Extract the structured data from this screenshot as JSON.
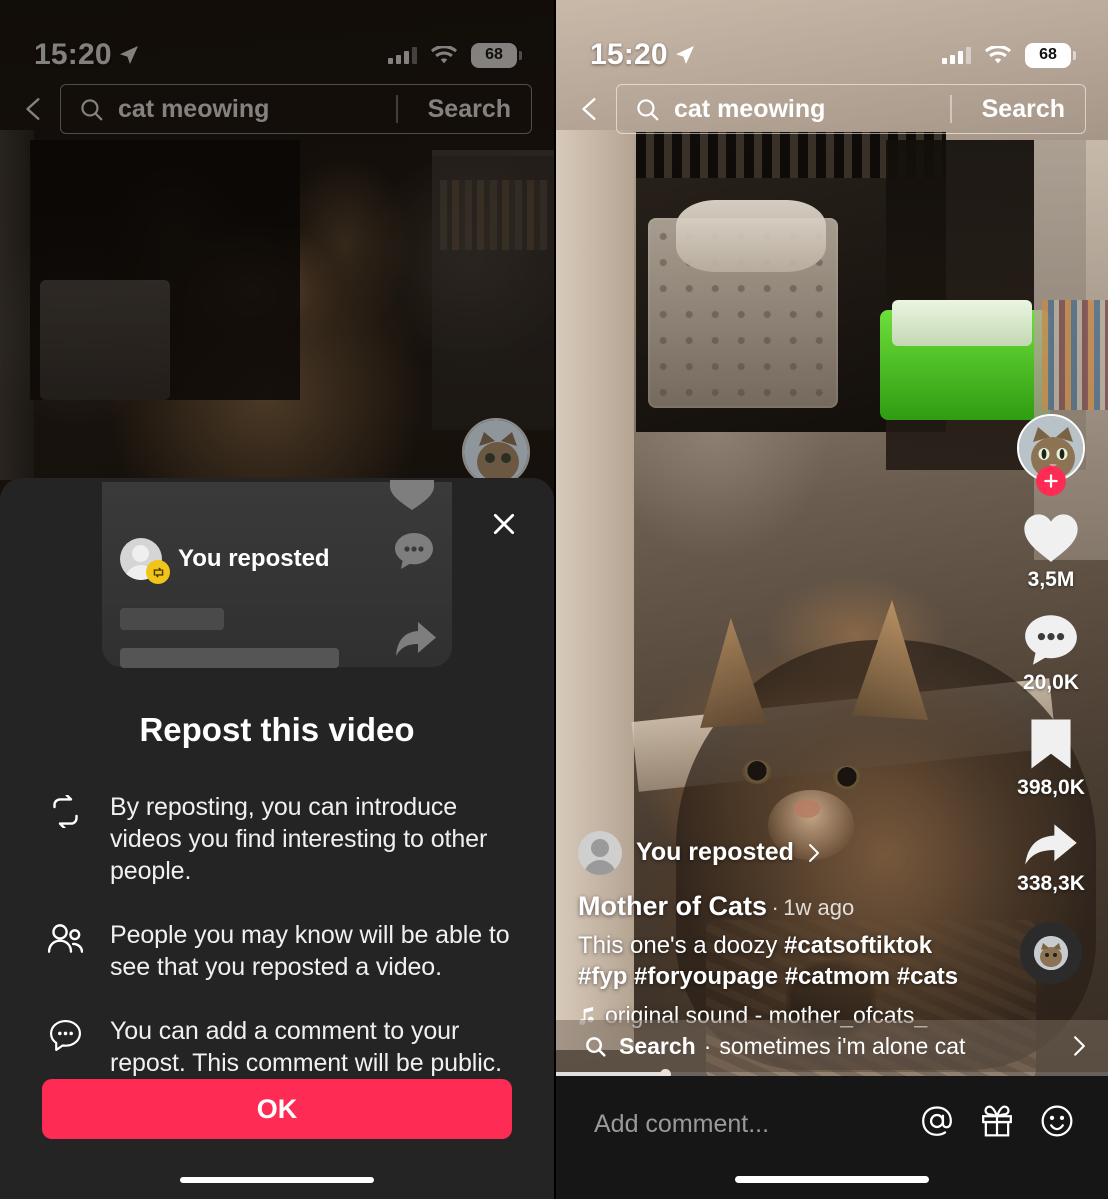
{
  "status_bar": {
    "time": "15:20",
    "location_icon": "location-arrow-icon",
    "signal_icon": "cellular-signal-icon",
    "wifi_icon": "wifi-icon",
    "battery_level": "68"
  },
  "search_header": {
    "back_icon": "chevron-left-icon",
    "search_icon": "search-icon",
    "query": "cat meowing",
    "search_button": "Search"
  },
  "repost_sheet": {
    "close_icon": "close-icon",
    "preview": {
      "reposted_label": "You reposted",
      "badge_icon": "repost-badge-icon",
      "heart_icon": "heart-icon",
      "comment_icon": "comment-icon",
      "share_icon": "share-arrow-icon"
    },
    "title": "Repost this video",
    "bullets": [
      {
        "icon": "repost-icon",
        "text": "By reposting, you can introduce videos you find interesting to other people."
      },
      {
        "icon": "people-icon",
        "text": "People you may know will be able to see that you reposted a video."
      },
      {
        "icon": "comment-icon",
        "text": "You can add a comment to your repost. This comment will be public."
      }
    ],
    "ok_button": "OK",
    "accent_color": "#fe2c55"
  },
  "video_feed": {
    "action_rail": {
      "avatar_icon": "profile-avatar",
      "follow_icon": "plus-icon",
      "items": [
        {
          "icon": "heart-icon",
          "count": "3,5M"
        },
        {
          "icon": "comment-icon",
          "count": "20,0K"
        },
        {
          "icon": "bookmark-icon",
          "count": "398,0K"
        },
        {
          "icon": "share-arrow-icon",
          "count": "338,3K"
        }
      ],
      "music_disc_icon": "music-disc-icon"
    },
    "caption": {
      "repost_label": "You reposted",
      "repost_chevron": "chevron-right-icon",
      "author": "Mother of Cats",
      "separator": "·",
      "timestamp": "1w ago",
      "description_plain": "This one's a doozy ",
      "hashtags_line1": "#catsoftiktok",
      "hashtags_line2": "#fyp #foryoupage #catmom #cats",
      "music_icon": "music-note-icon",
      "music": "original sound - mother_ofcats_"
    },
    "suggestion_bar": {
      "search_icon": "search-icon",
      "label": "Search",
      "separator": "·",
      "query": "sometimes i'm alone cat",
      "chevron_icon": "chevron-right-icon",
      "progress_percent": 20
    },
    "comment_bar": {
      "placeholder": "Add comment...",
      "icons": [
        "mention-icon",
        "gift-icon",
        "emoji-icon"
      ]
    }
  }
}
